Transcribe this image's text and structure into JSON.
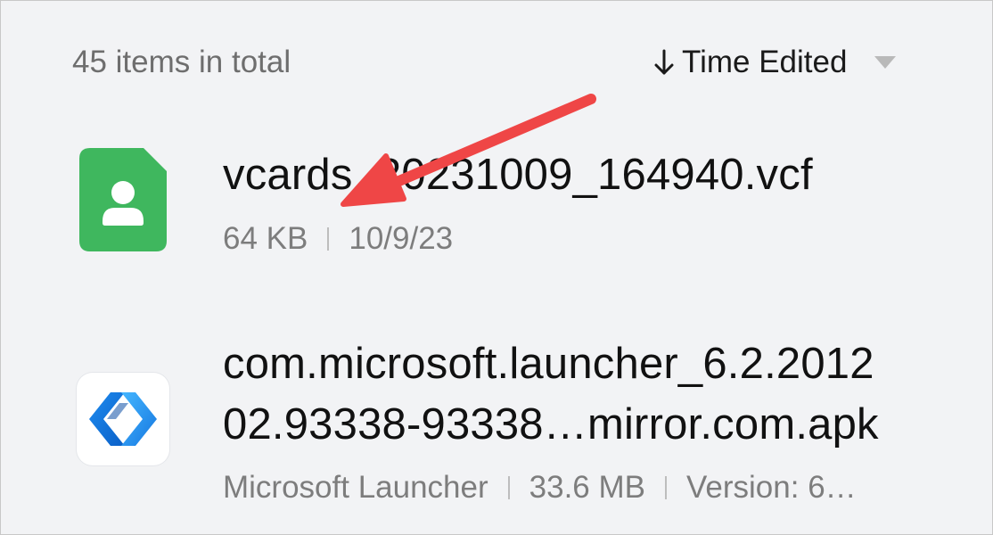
{
  "header": {
    "items_count": "45 items in total",
    "sort_label": "Time Edited",
    "sort_arrow_icon": "arrow-down-icon",
    "sort_menu_icon": "caret-down-icon"
  },
  "files": [
    {
      "icon": "contact-file-icon",
      "icon_color": "#3fb75e",
      "name": "vcards_20231009_164940.vcf",
      "size": "64 KB",
      "date": "10/9/23"
    },
    {
      "icon": "microsoft-launcher-icon",
      "name_line1": "com.microsoft.launcher_6.2.2012",
      "name_line2": "02.93338-93338…mirror.com.apk",
      "app_name": "Microsoft Launcher",
      "size": "33.6 MB",
      "version": "Version: 6…"
    }
  ],
  "annotation": {
    "icon": "red-pointer-arrow",
    "color": "#ef4646"
  }
}
